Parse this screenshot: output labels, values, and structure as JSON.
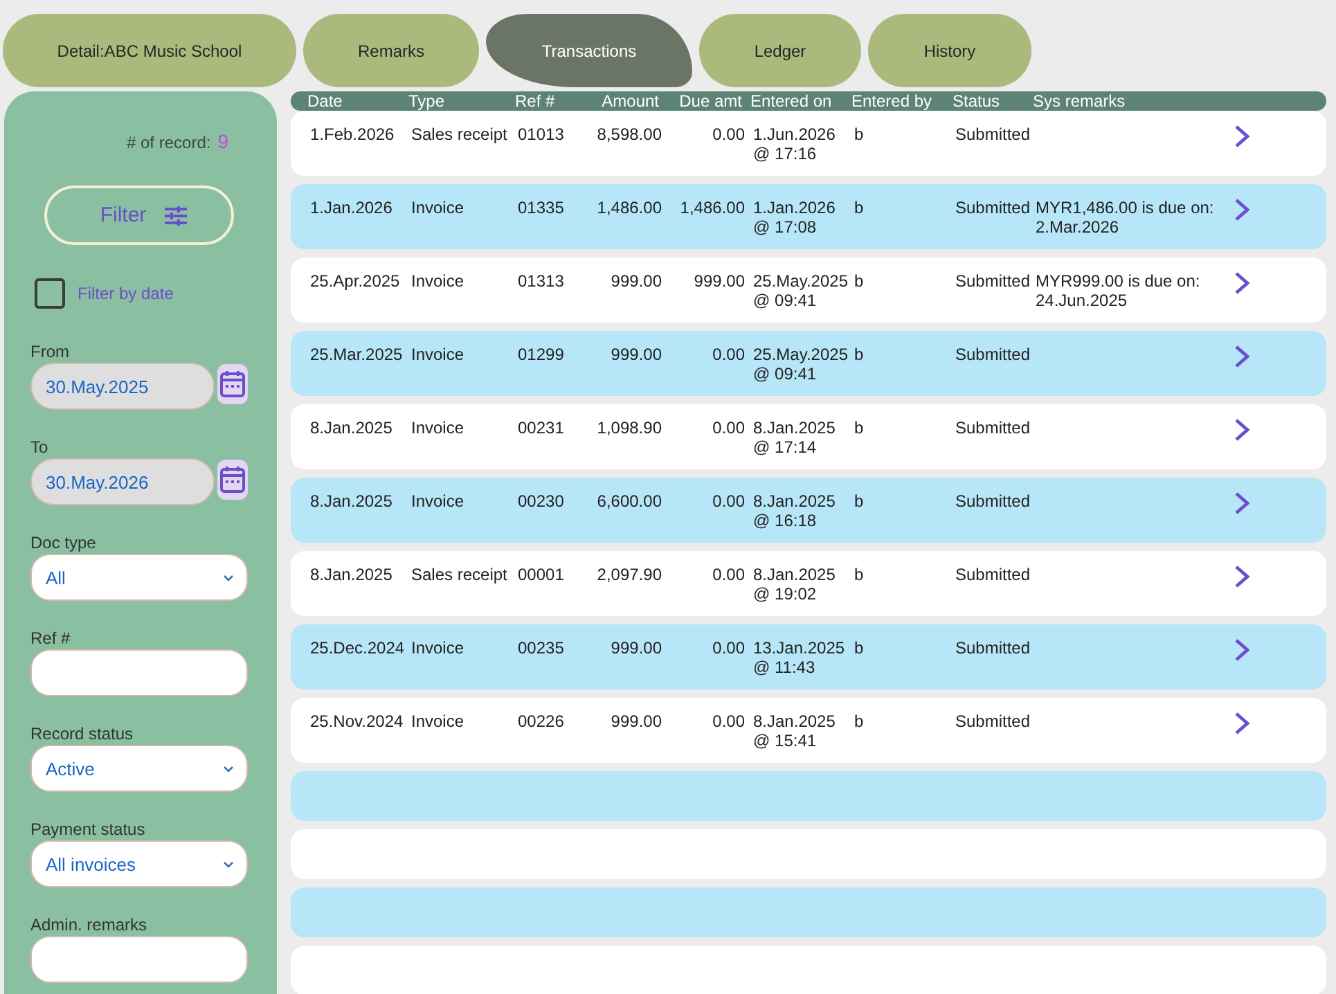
{
  "tabs": [
    {
      "label": "Detail:ABC Music School",
      "selected": false
    },
    {
      "label": "Remarks",
      "selected": false
    },
    {
      "label": "Transactions",
      "selected": true
    },
    {
      "label": "Ledger",
      "selected": false
    },
    {
      "label": "History",
      "selected": false
    }
  ],
  "sidebar": {
    "record_count": {
      "label": "# of record:",
      "value": "9"
    },
    "filter_button": "Filter",
    "filter_by_date": {
      "label": "Filter by date",
      "checked": false
    },
    "fields": [
      {
        "kind": "date",
        "label": "From",
        "value": "30.May.2025"
      },
      {
        "kind": "date",
        "label": "To",
        "value": "30.May.2026"
      },
      {
        "kind": "select",
        "label": "Doc type",
        "value": "All"
      },
      {
        "kind": "text",
        "label": "Ref #"
      },
      {
        "kind": "select",
        "label": "Record status",
        "value": "Active"
      },
      {
        "kind": "select",
        "label": "Payment status",
        "value": "All invoices"
      },
      {
        "kind": "text",
        "label": "Admin. remarks"
      }
    ]
  },
  "table": {
    "columns": [
      "Date",
      "Type",
      "Ref #",
      "Amount",
      "Due amt",
      "Entered on",
      "Entered by",
      "Status",
      "Sys remarks"
    ],
    "rows": [
      {
        "kind": "data",
        "date": "1.Feb.2026",
        "type": "Sales receipt",
        "ref": "01013",
        "amount": "8,598.00",
        "due_amt": "0.00",
        "entered_on": "1.Jun.2026 @ 17:16",
        "entered_by": "b",
        "status": "Submitted"
      },
      {
        "kind": "data",
        "date": "1.Jan.2026",
        "type": "Invoice",
        "ref": "01335",
        "amount": "1,486.00",
        "due_amt": "1,486.00",
        "entered_on": "1.Jan.2026 @ 17:08",
        "entered_by": "b",
        "status": "Submitted",
        "sys_remarks": "MYR1,486.00 is due on: 2.Mar.2026"
      },
      {
        "kind": "data",
        "date": "25.Apr.2025",
        "type": "Invoice",
        "ref": "01313",
        "amount": "999.00",
        "due_amt": "999.00",
        "entered_on": "25.May.2025 @ 09:41",
        "entered_by": "b",
        "status": "Submitted",
        "sys_remarks": "MYR999.00 is due on: 24.Jun.2025"
      },
      {
        "kind": "data",
        "date": "25.Mar.2025",
        "type": "Invoice",
        "ref": "01299",
        "amount": "999.00",
        "due_amt": "0.00",
        "entered_on": "25.May.2025 @ 09:41",
        "entered_by": "b",
        "status": "Submitted"
      },
      {
        "kind": "data",
        "date": "8.Jan.2025",
        "type": "Invoice",
        "ref": "00231",
        "amount": "1,098.90",
        "due_amt": "0.00",
        "entered_on": "8.Jan.2025 @ 17:14",
        "entered_by": "b",
        "status": "Submitted"
      },
      {
        "kind": "data",
        "date": "8.Jan.2025",
        "type": "Invoice",
        "ref": "00230",
        "amount": "6,600.00",
        "due_amt": "0.00",
        "entered_on": "8.Jan.2025 @ 16:18",
        "entered_by": "b",
        "status": "Submitted"
      },
      {
        "kind": "data",
        "date": "8.Jan.2025",
        "type": "Sales receipt",
        "ref": "00001",
        "amount": "2,097.90",
        "due_amt": "0.00",
        "entered_on": "8.Jan.2025 @ 19:02",
        "entered_by": "b",
        "status": "Submitted"
      },
      {
        "kind": "data",
        "date": "25.Dec.2024",
        "type": "Invoice",
        "ref": "00235",
        "amount": "999.00",
        "due_amt": "0.00",
        "entered_on": "13.Jan.2025 @ 11:43",
        "entered_by": "b",
        "status": "Submitted"
      },
      {
        "kind": "data",
        "date": "25.Nov.2024",
        "type": "Invoice",
        "ref": "00226",
        "amount": "999.00",
        "due_amt": "0.00",
        "entered_on": "8.Jan.2025 @ 15:41",
        "entered_by": "b",
        "status": "Submitted"
      },
      {
        "kind": "empty"
      },
      {
        "kind": "empty"
      },
      {
        "kind": "empty"
      },
      {
        "kind": "empty"
      }
    ]
  }
}
